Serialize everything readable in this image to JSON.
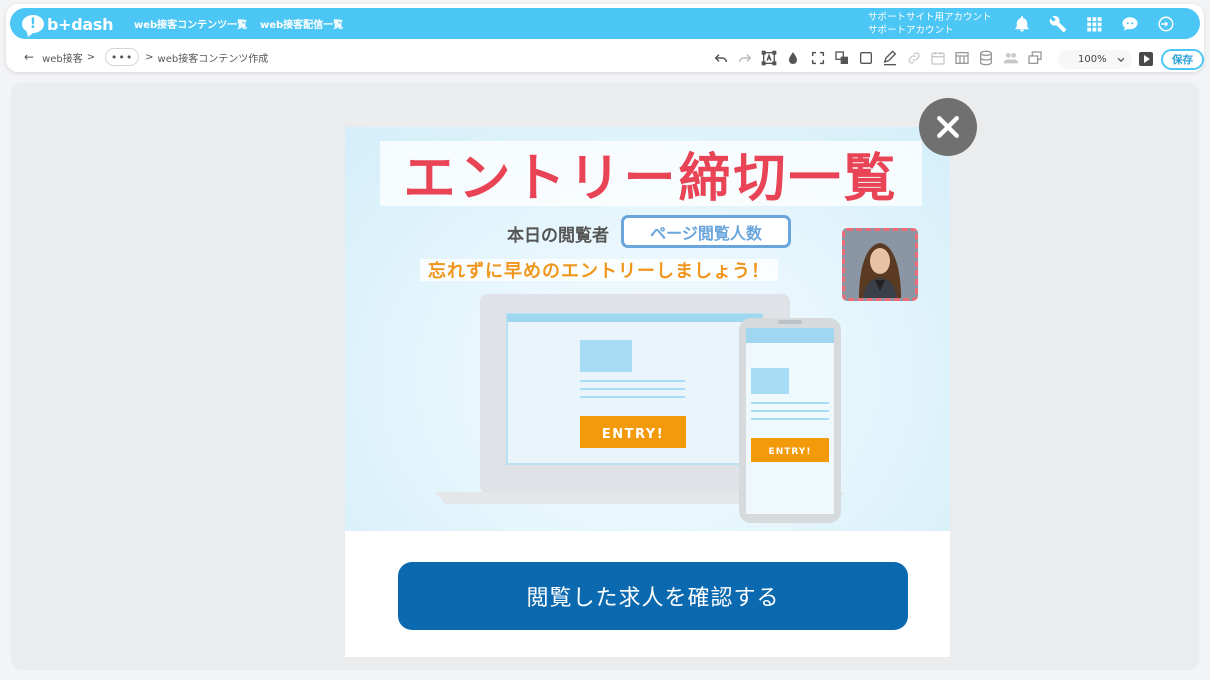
{
  "header": {
    "logo_text": "b+dash",
    "nav": [
      {
        "label": "web接客コンテンツ一覧"
      },
      {
        "label": "web接客配信一覧"
      }
    ],
    "account_line1": "サポートサイト用アカウント",
    "account_line2": "サポートアカウント",
    "icons": [
      "bell-icon",
      "wrench-icon",
      "apps-grid-icon",
      "chat-bot-icon",
      "logout-icon"
    ]
  },
  "breadcrumb": {
    "back_arrow": "←",
    "root": "web接客",
    "sep1": ">",
    "ellipsis": "•••",
    "sep2": ">",
    "current": "web接客コンテンツ作成"
  },
  "toolbar": {
    "icons": [
      "undo-icon",
      "redo-icon",
      "text-frame-icon",
      "fill-drop-icon",
      "resize-icon",
      "layer-icon",
      "rectangle-icon",
      "pen-icon",
      "link-icon",
      "calendar-icon",
      "table-icon",
      "database-icon",
      "users-icon",
      "copy-icon"
    ],
    "zoom": "100%",
    "save_label": "保存"
  },
  "popup": {
    "title": "エントリー締切一覧",
    "viewer_label": "本日の閲覧者",
    "viewer_count": "ページ閲覧人数",
    "message": "忘れずに早めのエントリーしましょう！",
    "laptop_entry": "ENTRY!",
    "phone_entry": "ENTRY!",
    "cta": "閲覧した求人を確認する"
  },
  "colors": {
    "brand": "#4cc6f4",
    "title_red": "#e84455",
    "message_orange": "#f0961c",
    "cta_blue": "#0b69b0",
    "entry_orange": "#f29a0a"
  }
}
